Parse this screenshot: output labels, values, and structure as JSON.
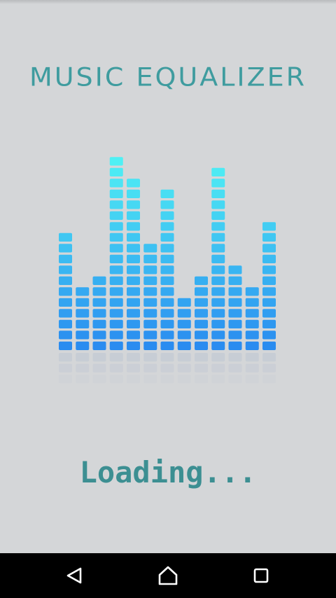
{
  "app": {
    "title": "MUSIC EQUALIZER",
    "loading_text": "Loading..."
  },
  "equalizer": {
    "bar_levels": [
      11,
      6,
      7,
      18,
      16,
      10,
      15,
      5,
      7,
      17,
      8,
      6,
      12
    ],
    "colors": {
      "bottom": "#2a8cf0",
      "top": "#4ff0f4",
      "reflection": "#c3cad4"
    }
  },
  "navbar": {
    "back_icon": "back-triangle-icon",
    "home_icon": "home-icon",
    "recents_icon": "recents-square-icon"
  },
  "theme": {
    "background": "#d4d6d8",
    "accent": "#3f9c9f"
  }
}
